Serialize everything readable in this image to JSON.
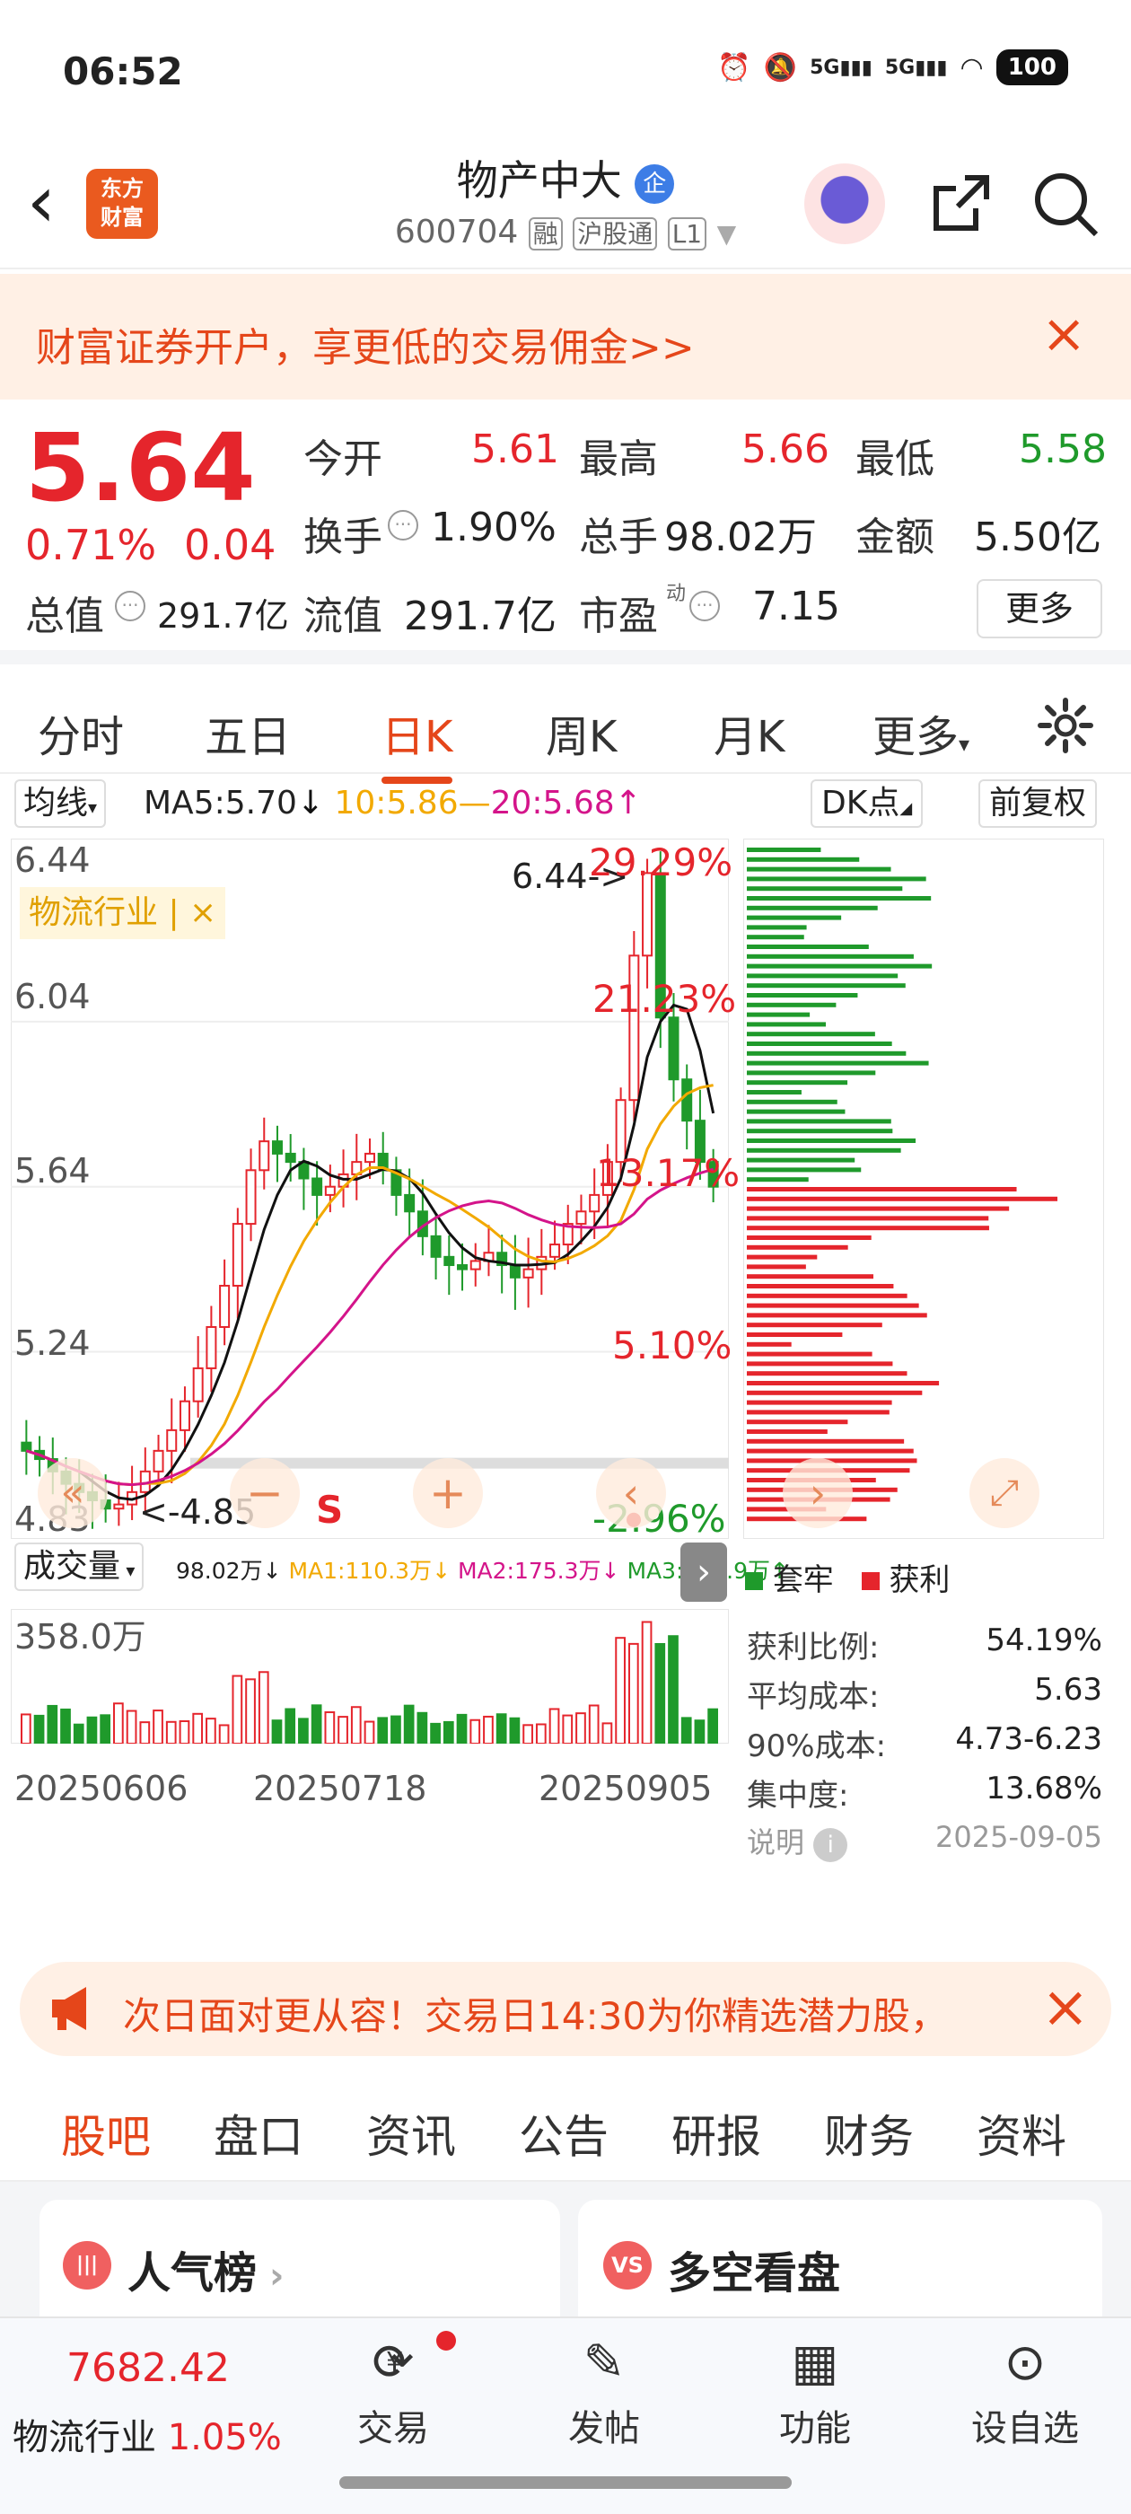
{
  "status": {
    "time": "06:52",
    "net1": "5G",
    "net2": "5G",
    "battery": "100"
  },
  "header": {
    "logo": "东方\n财富",
    "title": "物产中大",
    "badge": "企",
    "code": "600704",
    "tags": [
      "融",
      "沪股通",
      "L1"
    ]
  },
  "banner": {
    "text": "财富证券开户，享更低的交易佣金>>"
  },
  "quote": {
    "price": "5.64",
    "pct": "0.71%",
    "chg": "0.04",
    "rows": [
      [
        {
          "label": "今开",
          "value": "5.61"
        },
        {
          "label": "最高",
          "value": "5.66"
        },
        {
          "label": "最低",
          "value": "5.58"
        }
      ],
      [
        {
          "label": "换手",
          "value": "1.90%"
        },
        {
          "label": "总手",
          "value": "98.02万"
        },
        {
          "label": "金额",
          "value": "5.50亿"
        }
      ],
      [
        {
          "label": "总值",
          "value": "291.7亿"
        },
        {
          "label": "流值",
          "value": "291.7亿"
        },
        {
          "label": "市盈",
          "value": "7.15"
        }
      ]
    ],
    "pe_sup": "动",
    "more": "更多"
  },
  "tabs": [
    "分时",
    "五日",
    "日K",
    "周K",
    "月K",
    "更多"
  ],
  "chart": {
    "ma_label": "均线",
    "ma5": "MA5:5.70",
    "ma10": "10:5.86",
    "ma20": "20:5.68",
    "dk": "DK点",
    "fq": "前复权",
    "industry_tag": "物流行业",
    "price_ticks": [
      "6.44",
      "6.04",
      "5.64",
      "5.24",
      "4.83"
    ],
    "high_note": "6.44->",
    "low_note": "<-4.85",
    "s_mark": "S",
    "pct_labels": [
      "29.29%",
      "21.23%",
      "13.17%",
      "5.10%",
      "-2.96%"
    ],
    "vol_label": "成交量",
    "vol_stats": {
      "v": "98.02万",
      "ma1": "MA1:110.3万",
      "ma2": "MA2:175.3万",
      "ma3": "MA3:123.9万"
    },
    "vol_max": "358.0万",
    "dates": [
      "20250606",
      "20250718",
      "20250905"
    ],
    "chip": {
      "legend_trapped": "套牢",
      "legend_profit": "获利",
      "stats": [
        {
          "label": "获利比例:",
          "value": "54.19%"
        },
        {
          "label": "平均成本:",
          "value": "5.63"
        },
        {
          "label": "90%成本:",
          "value": "4.73-6.23"
        },
        {
          "label": "集中度:",
          "value": "13.68%"
        }
      ],
      "note": "说明",
      "date": "2025-09-05"
    },
    "colors": {
      "up": "#e5252c",
      "down": "#1f9a2b",
      "ma5": "#111111",
      "ma10": "#f2a900",
      "ma20": "#d4148a"
    }
  },
  "ad": {
    "text": "次日面对更从容！交易日14:30为你精选潜力股，"
  },
  "subtabs": [
    "股吧",
    "盘口",
    "资讯",
    "公告",
    "研报",
    "财务",
    "资料"
  ],
  "cards": [
    {
      "title": "人气榜",
      "icon": "|||"
    },
    {
      "title": "多空看盘",
      "icon": "VS"
    }
  ],
  "bottom": {
    "index_value": "7682.42",
    "index_name": "物流行业",
    "index_pct": "1.05%",
    "nav": [
      "交易",
      "发帖",
      "功能",
      "设自选"
    ]
  }
}
